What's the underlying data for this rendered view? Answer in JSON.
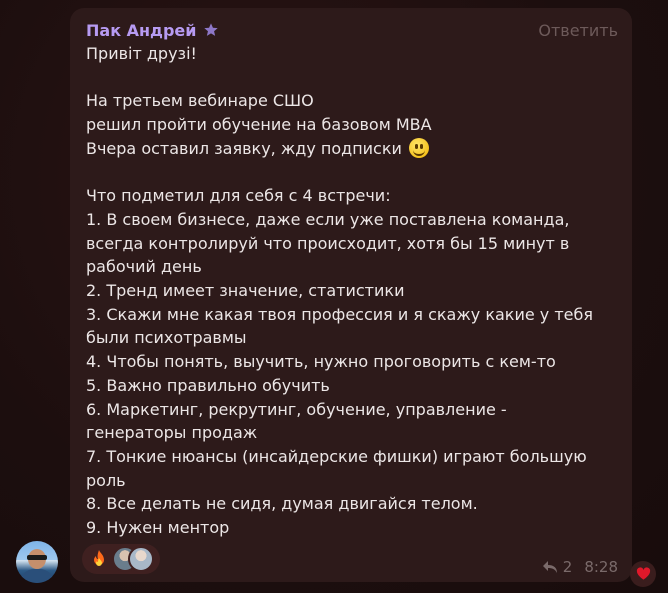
{
  "message": {
    "author": "Пак Андрей",
    "reply_label": "Ответить",
    "lines": [
      "Привіт друзі!",
      "",
      "На третьем вебинаре СШО",
      "решил пройти обучение на базовом МВА",
      "Вчера оставил заявку, жду подписки",
      "",
      "Что подметил для себя с 4 встречи:",
      "1. В своем бизнесе, даже если уже поставлена команда,",
      "всегда контролируй что происходит, хотя бы 15 минут в",
      "рабочий день",
      "2. Тренд имеет значение, статистики",
      "3. Скажи мне какая твоя профессия и я скажу какие у тебя",
      "были психотравмы",
      "4. Чтобы понять, выучить, нужно проговорить с кем-то",
      "5. Важно правильно обучить",
      "6. Маркетинг, рекрутинг, обучение, управление -",
      "генераторы продаж",
      "7. Тонкие нюансы (инсайдерские фишки) играют большую",
      "роль",
      "8. Все делать не сидя, думая двигайся телом.",
      "9. Нужен ментор"
    ],
    "reply_count": "2",
    "time": "8:28"
  },
  "icons": {
    "author_badge": "star-icon",
    "emoji": "smile-emoji-icon",
    "reaction": "fire-icon",
    "reply_count": "reply-arrow-icon",
    "own_reaction": "heart-icon"
  },
  "colors": {
    "background": "#1e0f0f",
    "bubble": "#2d1a1a",
    "author": "#b79bf2",
    "text": "#ece6e6",
    "muted": "#7a6a6a",
    "heart": "#e0182a"
  }
}
